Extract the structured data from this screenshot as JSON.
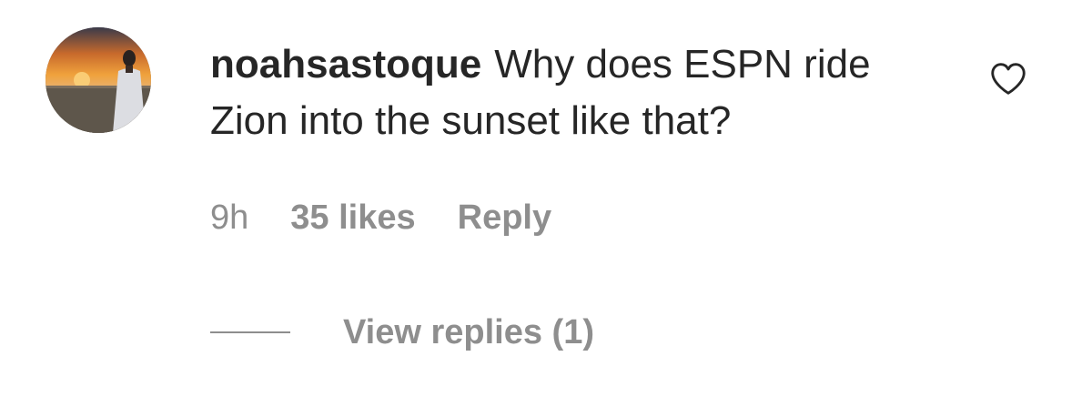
{
  "comment": {
    "avatar_icon": "profile-photo-sunset",
    "username": "noahsastoque",
    "text": "Why does ESPN ride Zion into the sunset like that?",
    "like_icon": "heart-outline-icon"
  },
  "meta": {
    "time": "9h",
    "likes": "35 likes",
    "reply_label": "Reply"
  },
  "replies": {
    "view_label": "View replies (1)"
  },
  "colors": {
    "text_primary": "#262626",
    "text_secondary": "#8e8e8e",
    "background": "#ffffff"
  }
}
